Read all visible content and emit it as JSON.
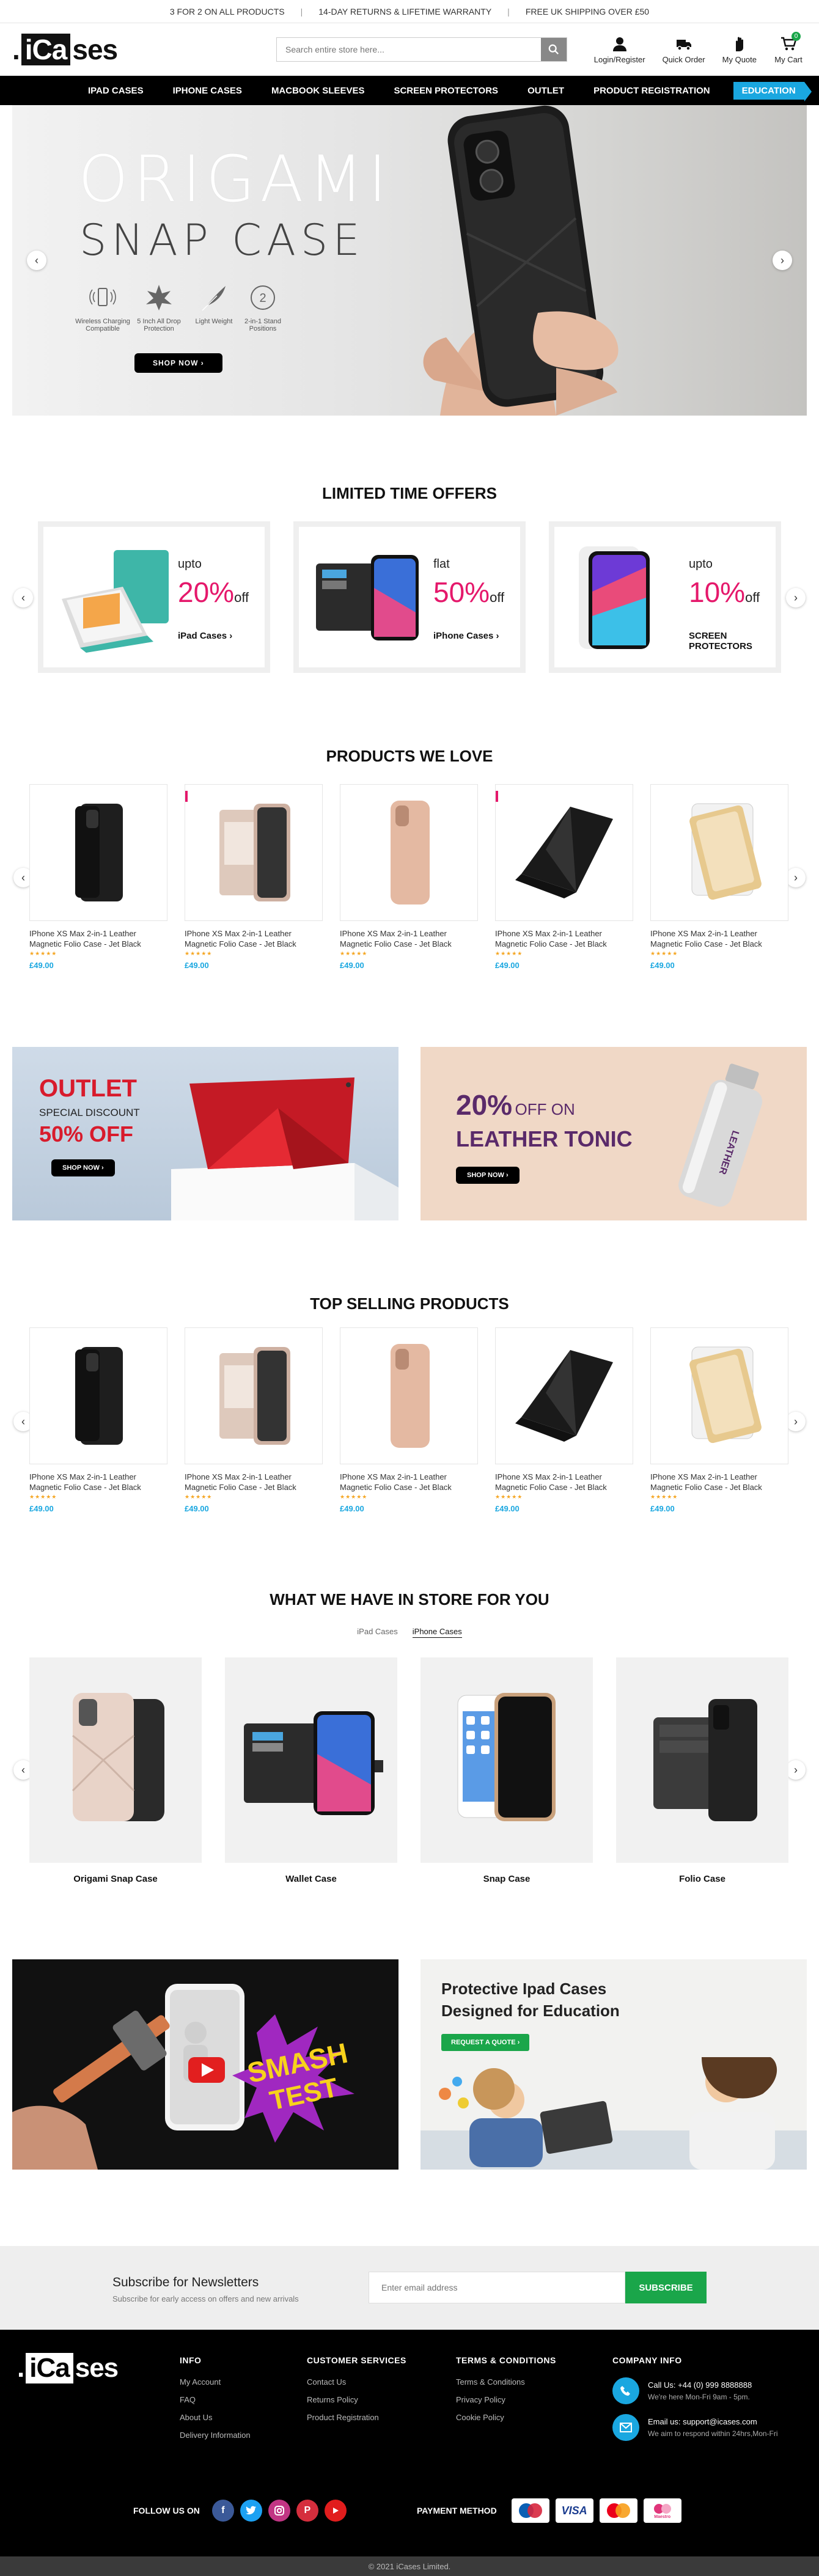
{
  "topbar": {
    "promo1": "3 FOR 2 ON ALL PRODUCTS",
    "promo2": "14-DAY RETURNS & LIFETIME WARRANTY",
    "promo3": "FREE UK SHIPPING OVER £50",
    "separator": "|"
  },
  "header": {
    "logo_prefix": ".",
    "logo_box": "iCa",
    "logo_suffix": "ses",
    "search_placeholder": "Search entire store here...",
    "account": "Login/Register",
    "quick_order": "Quick Order",
    "quote": "My Quote",
    "cart": "My Cart",
    "cart_count": "0"
  },
  "nav": {
    "items": [
      "IPAD CASES",
      "IPHONE CASES",
      "MACBOOK SLEEVES",
      "SCREEN PROTECTORS",
      "OUTLET",
      "PRODUCT REGISTRATION"
    ],
    "highlight": "EDUCATION"
  },
  "hero": {
    "title": "ORIGAMI",
    "subtitle": "SNAP CASE",
    "features": [
      {
        "label": "Wireless Charging Compatible",
        "icon": "wireless-charging-icon"
      },
      {
        "label": "5 Inch All Drop Protection",
        "icon": "drop-protection-icon"
      },
      {
        "label": "Light Weight",
        "icon": "feather-icon"
      },
      {
        "label": "2-in-1 Stand Positions",
        "icon": "two-in-one-icon"
      }
    ],
    "cta": "SHOP NOW",
    "cta_arrow": "›",
    "prev": "‹",
    "next": "›"
  },
  "offers": {
    "title": "LIMITED TIME OFFERS",
    "items": [
      {
        "pre": "upto",
        "pct": "20%",
        "suffix": "off",
        "category": "iPad Cases ›"
      },
      {
        "pre": "flat",
        "pct": "50%",
        "suffix": "off",
        "category": "iPhone Cases ›"
      },
      {
        "pre": "upto",
        "pct": "10%",
        "suffix": "off",
        "category": "SCREEN PROTECTORS"
      }
    ]
  },
  "products_love": {
    "title": "PRODUCTS WE LOVE",
    "items": [
      {
        "name": "IPhone XS Max 2-in-1 Leather Magnetic Folio Case - Jet Black",
        "price": "£49.00",
        "stars": "★★★★★",
        "rating": 5
      },
      {
        "name": "IPhone XS Max 2-in-1 Leather Magnetic Folio Case - Jet Black",
        "price": "£49.00",
        "stars": "★★★★★",
        "rating": 5
      },
      {
        "name": "IPhone XS Max 2-in-1 Leather Magnetic Folio Case - Jet Black",
        "price": "£49.00",
        "stars": "★★★★★",
        "rating": 5
      },
      {
        "name": "IPhone XS Max 2-in-1 Leather Magnetic Folio Case - Jet Black",
        "price": "£49.00",
        "stars": "★★★★★",
        "rating": 5
      },
      {
        "name": "IPhone XS Max 2-in-1 Leather Magnetic Folio Case - Jet Black",
        "price": "£49.00",
        "stars": "★★★★★",
        "rating": 5
      }
    ]
  },
  "promo_banners": {
    "outlet_title": "OUTLET",
    "outlet_sub": "SPECIAL DISCOUNT",
    "outlet_pct": "50% OFF",
    "outlet_cta": "SHOP NOW",
    "tonic_pct": "20%",
    "tonic_off": "OFF ON",
    "tonic_name": "LEATHER TONIC",
    "tonic_cta": "SHOP NOW",
    "bottle_label": "LEATHER"
  },
  "top_selling": {
    "title": "TOP SELLING PRODUCTS",
    "items": [
      {
        "name": "IPhone XS Max 2-in-1 Leather Magnetic Folio Case - Jet Black",
        "price": "£49.00",
        "stars": "★★★★★",
        "rating": 5
      },
      {
        "name": "IPhone XS Max 2-in-1 Leather Magnetic Folio Case - Jet Black",
        "price": "£49.00",
        "stars": "★★★★★",
        "rating": 5
      },
      {
        "name": "IPhone XS Max 2-in-1 Leather Magnetic Folio Case - Jet Black",
        "price": "£49.00",
        "stars": "★★★★★",
        "rating": 5
      },
      {
        "name": "IPhone XS Max 2-in-1 Leather Magnetic Folio Case - Jet Black",
        "price": "£49.00",
        "stars": "★★★★★",
        "rating": 5
      },
      {
        "name": "IPhone XS Max 2-in-1 Leather Magnetic Folio Case - Jet Black",
        "price": "£49.00",
        "stars": "★★★★★",
        "rating": 5
      }
    ]
  },
  "store": {
    "title": "WHAT WE HAVE IN STORE FOR YOU",
    "tabs": [
      "iPad Cases",
      "iPhone Cases"
    ],
    "active_tab": "iPhone Cases",
    "items": [
      "Origami Snap Case",
      "Wallet Case",
      "Snap Case",
      "Folio Case"
    ]
  },
  "bottom_banners": {
    "smash_line1": "SMASH",
    "smash_line2": "TEST",
    "edu_title": "Protective Ipad Cases Designed for Education",
    "edu_cta": "REQUEST A QUOTE",
    "edu_cta_arrow": "›"
  },
  "newsletter": {
    "title": "Subscribe for Newsletters",
    "subtitle": "Subscribe for early access on offers and new arrivals",
    "placeholder": "Enter email address",
    "button": "SUBSCRIBE"
  },
  "footer": {
    "info_title": "INFO",
    "info_links": [
      "My Account",
      "FAQ",
      "About Us",
      "Delivery Information"
    ],
    "cs_title": "CUSTOMER SERVICES",
    "cs_links": [
      "Contact Us",
      "Returns Policy",
      "Product Registration"
    ],
    "terms_title": "TERMS & CONDITIONS",
    "terms_links": [
      "Terms & Conditions",
      "Privacy Policy",
      "Cookie Policy"
    ],
    "company_title": "COMPANY INFO",
    "call_label": "Call Us: +44 (0) 999 8888888",
    "call_sub": "We're here Mon-Fri 9am - 5pm.",
    "email_label": "Email us: support@icases.com",
    "email_sub": "We aim to respond within 24hrs,Mon-Fri",
    "follow": "FOLLOW US ON",
    "payment": "PAYMENT METHOD",
    "visa": "VISA",
    "maestro": "Maestro",
    "copyright": "© 2021 iCases Limited."
  },
  "colors": {
    "accent": "#1aa7e0",
    "pink": "#e5186b",
    "green": "#1aa64a",
    "outlet_red": "#d81b2c",
    "purple": "#5a2a6a"
  }
}
